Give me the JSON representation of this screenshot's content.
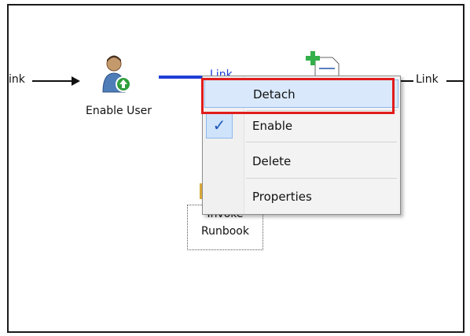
{
  "workflow": {
    "left_link_label": "ink",
    "blue_link_label": "Link",
    "right_link_label": "Link",
    "enable_user_label": "Enable User",
    "invoke_runbook_line1": "Invoke",
    "invoke_runbook_line2": "Runbook"
  },
  "context_menu": {
    "items": [
      {
        "label": "Detach",
        "highlighted": true
      },
      {
        "label": "Enable",
        "checked": true
      },
      {
        "label": "Delete"
      },
      {
        "label": "Properties"
      }
    ]
  },
  "colors": {
    "highlight_box": "#e11c1c",
    "blue_link": "#1f3fd6",
    "menu_highlight": "#d9e9fb"
  },
  "icons": {
    "enable_user": "user-with-green-arrow-icon",
    "new_activity": "document-with-green-plus-icon",
    "invoke_runbook": "runbook-icon",
    "checkmark": "checkmark-icon"
  }
}
